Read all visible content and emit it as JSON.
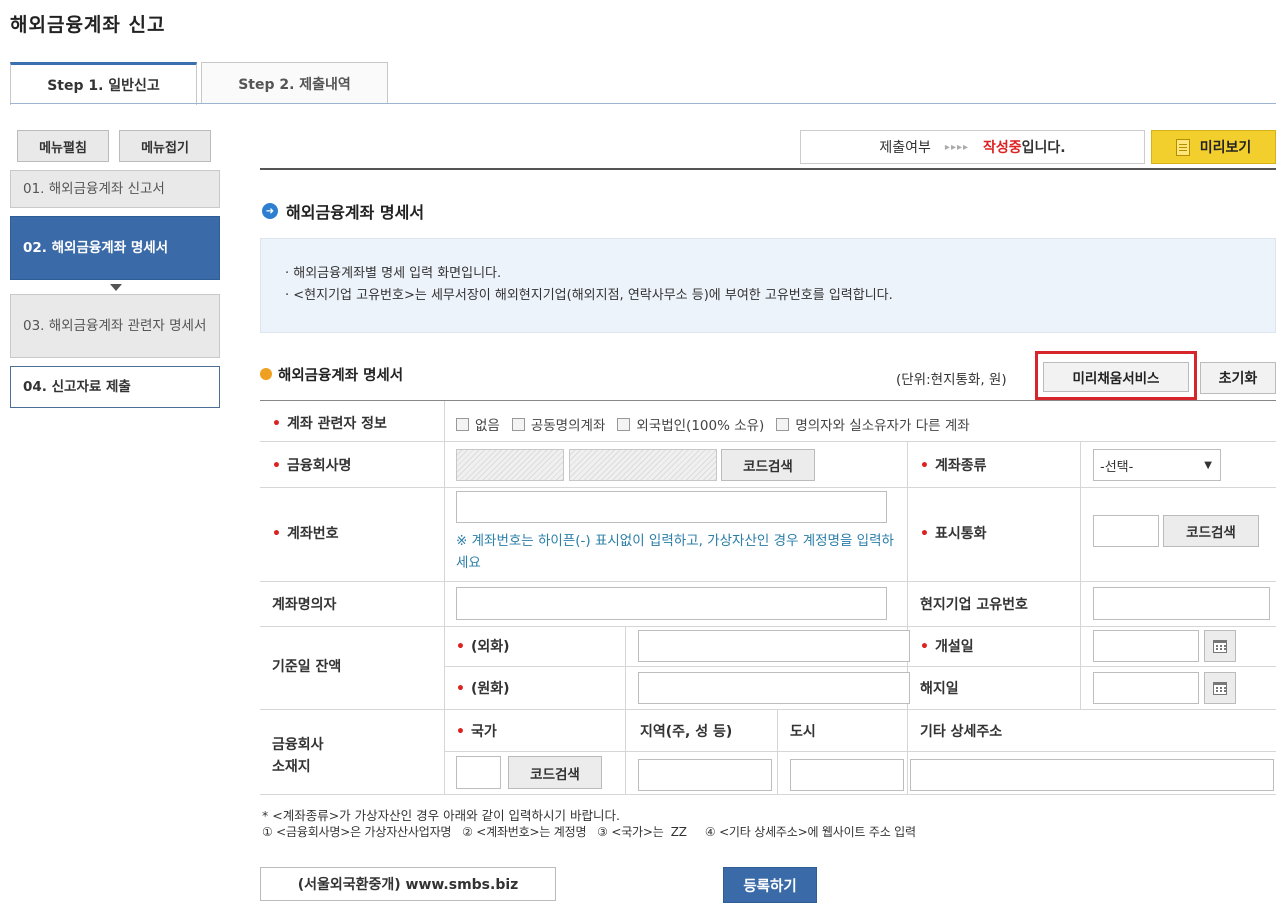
{
  "page": {
    "title": "해외금융계좌 신고"
  },
  "tabs": [
    {
      "label": "Step 1. 일반신고",
      "active": true
    },
    {
      "label": "Step 2. 제출내역",
      "active": false
    }
  ],
  "sidebar": {
    "expand_label": "메뉴펼침",
    "collapse_label": "메뉴접기",
    "items": [
      {
        "label": "01. 해외금융계좌 신고서",
        "state": "normal"
      },
      {
        "label": "02. 해외금융계좌 명세서",
        "state": "active"
      },
      {
        "label": "03. 해외금융계좌 관련자 명세서",
        "state": "normal"
      },
      {
        "label": "04. 신고자료 제출",
        "state": "plain"
      }
    ]
  },
  "status": {
    "label": "제출여부",
    "arrows": "▸▸▸▸",
    "value": "작성중",
    "suffix": "입니다.",
    "preview_label": "미리보기"
  },
  "section": {
    "title": "해외금융계좌 명세서",
    "info": [
      "· 해외금융계좌별 명세 입력 화면입니다.",
      "· <현지기업 고유번호>는 세무서장이 해외현지기업(해외지점, 연락사무소 등)에 부여한 고유번호를 입력합니다."
    ],
    "subtitle": "해외금융계좌 명세서",
    "unit": "(단위:현지통화, 원)",
    "fetch_label": "미리채움서비스",
    "reset_label": "초기화"
  },
  "form": {
    "related_info_label": "계좌 관련자 정보",
    "checkboxes": [
      "없음",
      "공동명의계좌",
      "외국법인(100% 소유)",
      "명의자와 실소유자가 다른 계좌"
    ],
    "institution_label": "금융회사명",
    "code_search_label": "코드검색",
    "account_type_label": "계좌종류",
    "account_type_value": "-선택-",
    "account_number_label": "계좌번호",
    "account_number_note": "※ 계좌번호는 하이픈(-) 표시없이 입력하고, 가상자산인 경우 계정명을 입력하세요",
    "currency_label": "표시통화",
    "holder_label": "계좌명의자",
    "local_id_label": "현지기업 고유번호",
    "balance_label": "기준일 잔액",
    "foreign_label": "(외화)",
    "krw_label": "(원화)",
    "open_date_label": "개설일",
    "close_date_label": "해지일",
    "location_label_1": "금융회사",
    "location_label_2": "소재지",
    "country_label": "국가",
    "region_label": "지역(주, 성 등)",
    "city_label": "도시",
    "detail_address_label": "기타 상세주소"
  },
  "footer": {
    "note_1": "* <계좌종류>가 가상자산인 경우 아래와 같이 입력하시기 바랍니다.",
    "note_2": "① <금융회사명>은 가상자산사업자명   ② <계좌번호>는 계정명   ③ <국가>는  ZZ     ④ <기타 상세주소>에 웹사이트 주소 입력",
    "site_label": "(서울외국환중개) www.smbs.biz",
    "submit_label": "등록하기"
  }
}
